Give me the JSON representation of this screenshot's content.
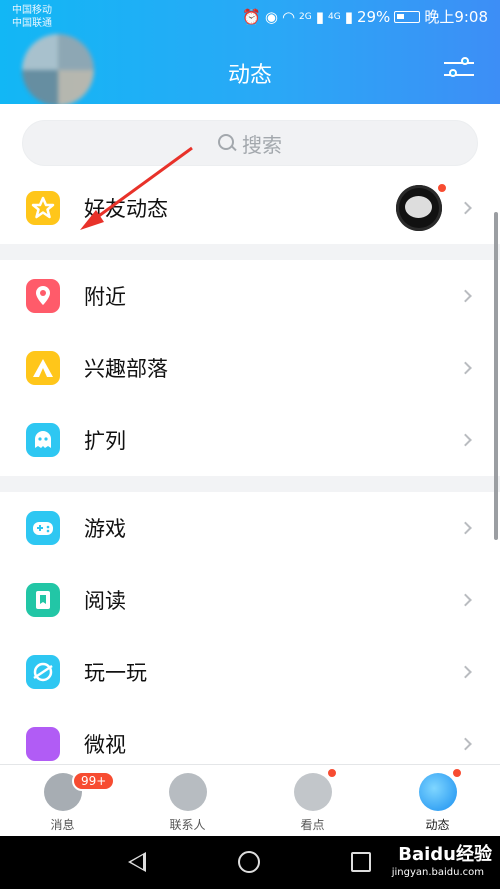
{
  "status_bar": {
    "carrier_1": "中国移动",
    "carrier_2": "中国联通",
    "net_2g": "2G",
    "net_4g": "4G",
    "battery": "29%",
    "time": "晚上9:08"
  },
  "header": {
    "title": "动态",
    "settings_icon": "sliders-icon"
  },
  "search": {
    "placeholder": "搜索"
  },
  "sections": [
    {
      "items": [
        {
          "label": "好友动态",
          "icon": "star-icon",
          "color": "#ffc61a"
        }
      ]
    },
    {
      "items": [
        {
          "label": "附近",
          "icon": "location-pin-icon",
          "color": "#ff5b6a"
        },
        {
          "label": "兴趣部落",
          "icon": "tent-icon",
          "color": "#ffc61a"
        },
        {
          "label": "扩列",
          "icon": "chat-ghost-icon",
          "color": "#2ec7f2"
        }
      ]
    },
    {
      "items": [
        {
          "label": "游戏",
          "icon": "gamepad-icon",
          "color": "#2ec7f2"
        },
        {
          "label": "阅读",
          "icon": "book-icon",
          "color": "#22c6a6"
        },
        {
          "label": "玩一玩",
          "icon": "planet-icon",
          "color": "#2ec7f2"
        },
        {
          "label": "微视",
          "icon": "video-icon",
          "color": "#b15cf5"
        }
      ]
    }
  ],
  "tabbar": {
    "tabs": [
      {
        "label": "消息",
        "badge": "99+"
      },
      {
        "label": "联系人"
      },
      {
        "label": "看点"
      },
      {
        "label": "动态"
      }
    ]
  },
  "watermark": {
    "brand": "Baidu经验",
    "url": "jingyan.baidu.com"
  },
  "colors": {
    "accent": "#12b7f5",
    "badge_red": "#f74c31",
    "annotation_red": "#e8322a"
  }
}
